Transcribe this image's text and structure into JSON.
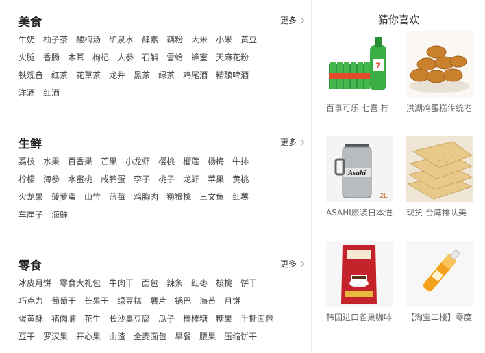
{
  "sections": [
    {
      "title": "美食",
      "more": "更多",
      "rows": [
        [
          "牛奶",
          "柚子茶",
          "酸梅汤",
          "矿泉水",
          "酵素",
          "藕粉",
          "大米",
          "小米",
          "黄豆"
        ],
        [
          "火腿",
          "香肠",
          "木耳",
          "枸杞",
          "人参",
          "石斛",
          "雪蛤",
          "蜂蜜",
          "天麻花粉"
        ],
        [
          "铁观音",
          "红茶",
          "花草茶",
          "龙井",
          "黑茶",
          "绿茶",
          "鸡尾酒",
          "精酿啤酒"
        ],
        [
          "洋酒",
          "红酒"
        ]
      ]
    },
    {
      "title": "生鲜",
      "more": "更多",
      "rows": [
        [
          "荔枝",
          "水果",
          "百香果",
          "芒果",
          "小龙虾",
          "樱桃",
          "榴莲",
          "杨梅",
          "牛排"
        ],
        [
          "柠檬",
          "海参",
          "水蜜桃",
          "咸鸭蛋",
          "李子",
          "桃子",
          "龙虾",
          "苹果",
          "黄桃"
        ],
        [
          "火龙果",
          "菠萝蜜",
          "山竹",
          "蓝莓",
          "鸡胸肉",
          "猕猴桃",
          "三文鱼",
          "红薯"
        ],
        [
          "车厘子",
          "海鲜"
        ]
      ]
    },
    {
      "title": "零食",
      "more": "更多",
      "rows": [
        [
          "冰皮月饼",
          "零食大礼包",
          "牛肉干",
          "面包",
          "辣条",
          "红枣",
          "核桃",
          "饼干"
        ],
        [
          "巧克力",
          "葡萄干",
          "芒果干",
          "绿豆糕",
          "薯片",
          "锅巴",
          "海苔",
          "月饼"
        ],
        [
          "蛋黄酥",
          "猪肉脯",
          "花生",
          "长沙臭豆腐",
          "瓜子",
          "棒棒糖",
          "糖果",
          "手撕面包"
        ],
        [
          "豆干",
          "罗汉果",
          "开心果",
          "山渣",
          "全麦面包",
          "早餐",
          "腰果",
          "压缩饼干"
        ]
      ]
    }
  ],
  "recommend": {
    "title": "猜你喜欢",
    "items": [
      {
        "caption": "百事可乐 七喜 柠",
        "icon": "soda-bottles-image"
      },
      {
        "caption": "洪湖鸡蛋糕传统老",
        "icon": "egg-cakes-image"
      },
      {
        "caption": "ASAHI原装日本进",
        "icon": "beer-keg-image",
        "image_text": "2L",
        "brand_text": "Asahi"
      },
      {
        "caption": "现货 台湾排队美",
        "icon": "crackers-image"
      },
      {
        "caption": "韩国进口雀巢咖啡",
        "icon": "coffee-pack-image"
      },
      {
        "caption": "【淘宝二楼】零度",
        "icon": "juice-bottle-image"
      }
    ]
  }
}
